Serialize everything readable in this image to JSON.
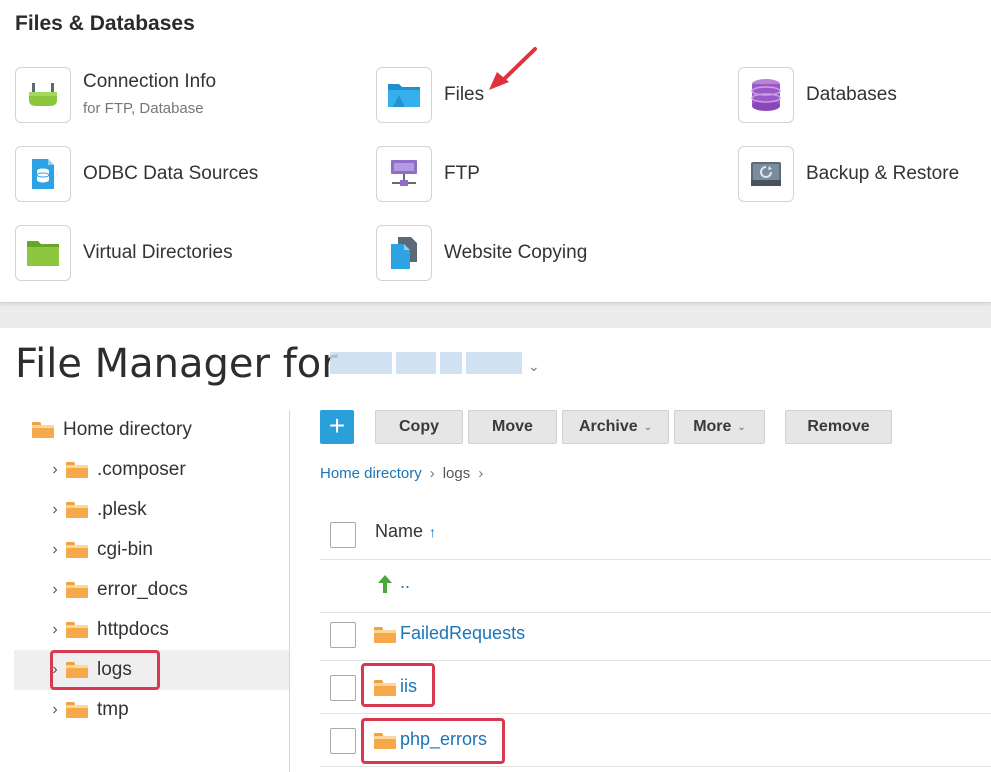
{
  "files_databases": {
    "title": "Files & Databases",
    "tools": [
      {
        "label": "Connection Info",
        "sublabel": "for FTP, Database",
        "icon": "connection-plug-icon"
      },
      {
        "label": "Files",
        "icon": "files-folder-icon"
      },
      {
        "label": "Databases",
        "icon": "database-icon"
      },
      {
        "label": "ODBC Data Sources",
        "icon": "odbc-icon"
      },
      {
        "label": "FTP",
        "icon": "ftp-network-icon"
      },
      {
        "label": "Backup & Restore",
        "icon": "backup-restore-icon"
      },
      {
        "label": "Virtual Directories",
        "icon": "virtual-directory-icon"
      },
      {
        "label": "Website Copying",
        "icon": "website-copy-icon"
      }
    ]
  },
  "file_manager": {
    "title": "File Manager for",
    "tree": {
      "root": "Home directory",
      "children": [
        ".composer",
        ".plesk",
        "cgi-bin",
        "error_docs",
        "httpdocs",
        "logs",
        "tmp"
      ],
      "selected": "logs"
    },
    "toolbar": {
      "add_label": "+",
      "copy": "Copy",
      "move": "Move",
      "archive": "Archive",
      "more": "More",
      "remove": "Remove"
    },
    "breadcrumb": {
      "home": "Home directory",
      "current": "logs"
    },
    "list": {
      "name_header": "Name",
      "sort_indicator": "↑",
      "parent": "..",
      "rows": [
        "FailedRequests",
        "iis",
        "php_errors"
      ]
    }
  },
  "colors": {
    "accent": "#2aa0da",
    "link": "#1a74b8",
    "highlight": "#d9394f",
    "folder": "#f6a94a"
  }
}
